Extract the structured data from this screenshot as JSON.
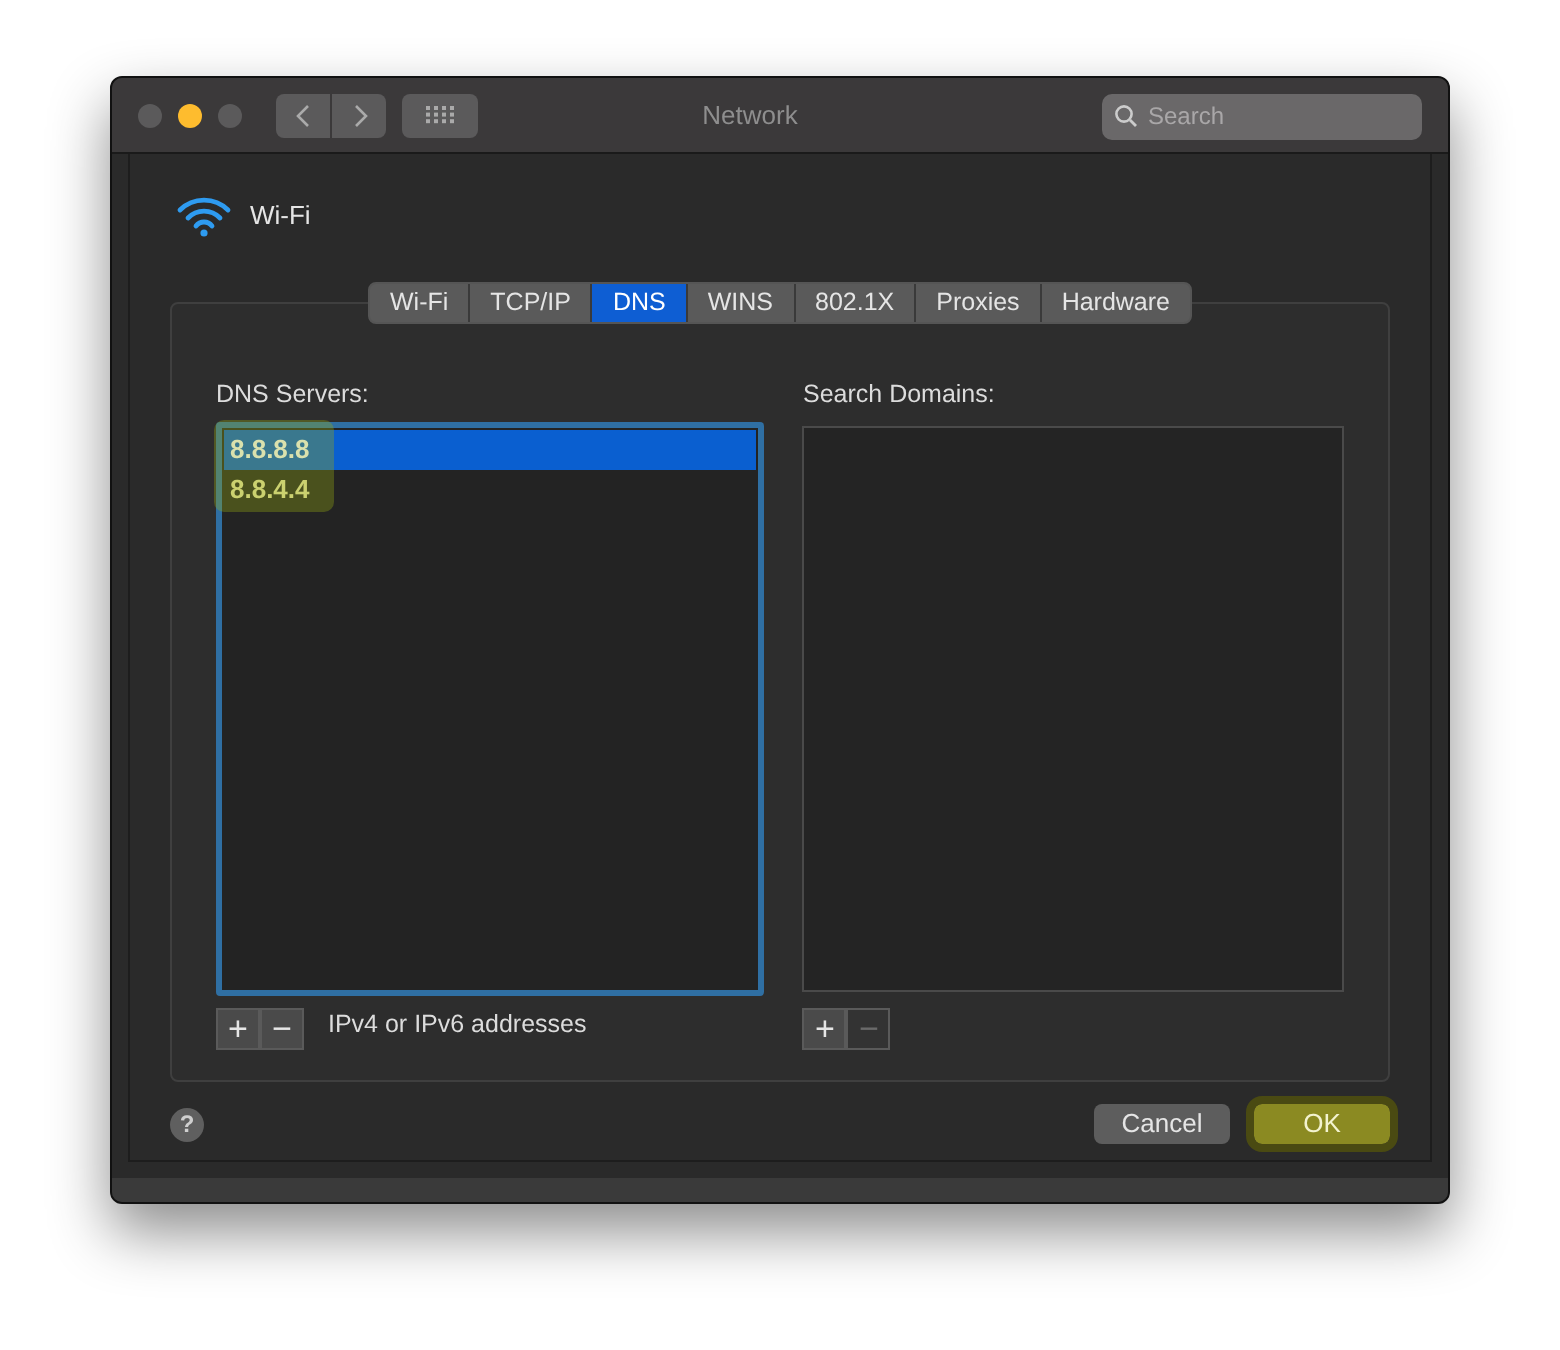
{
  "window": {
    "title": "Network",
    "search": {
      "placeholder": "Search"
    }
  },
  "service": {
    "name": "Wi-Fi"
  },
  "tabs": [
    {
      "label": "Wi-Fi",
      "selected": false
    },
    {
      "label": "TCP/IP",
      "selected": false
    },
    {
      "label": "DNS",
      "selected": true
    },
    {
      "label": "WINS",
      "selected": false
    },
    {
      "label": "802.1X",
      "selected": false
    },
    {
      "label": "Proxies",
      "selected": false
    },
    {
      "label": "Hardware",
      "selected": false
    }
  ],
  "dns_servers": {
    "label": "DNS Servers:",
    "highlight": true,
    "items": [
      {
        "address": "8.8.8.8",
        "selected": true
      },
      {
        "address": "8.8.4.4",
        "selected": false
      }
    ],
    "add": {
      "label": "+",
      "disabled": false
    },
    "remove": {
      "label": "−",
      "disabled": false
    },
    "hint": "IPv4 or IPv6 addresses"
  },
  "search_domains": {
    "label": "Search Domains:",
    "add": {
      "label": "+",
      "disabled": false
    },
    "remove": {
      "label": "−",
      "disabled": true
    }
  },
  "help": {
    "label": "?"
  },
  "buttons": [
    {
      "label": "Cancel",
      "kind": "normal",
      "highlight": false
    },
    {
      "label": "OK",
      "kind": "default",
      "highlight": true
    }
  ]
}
